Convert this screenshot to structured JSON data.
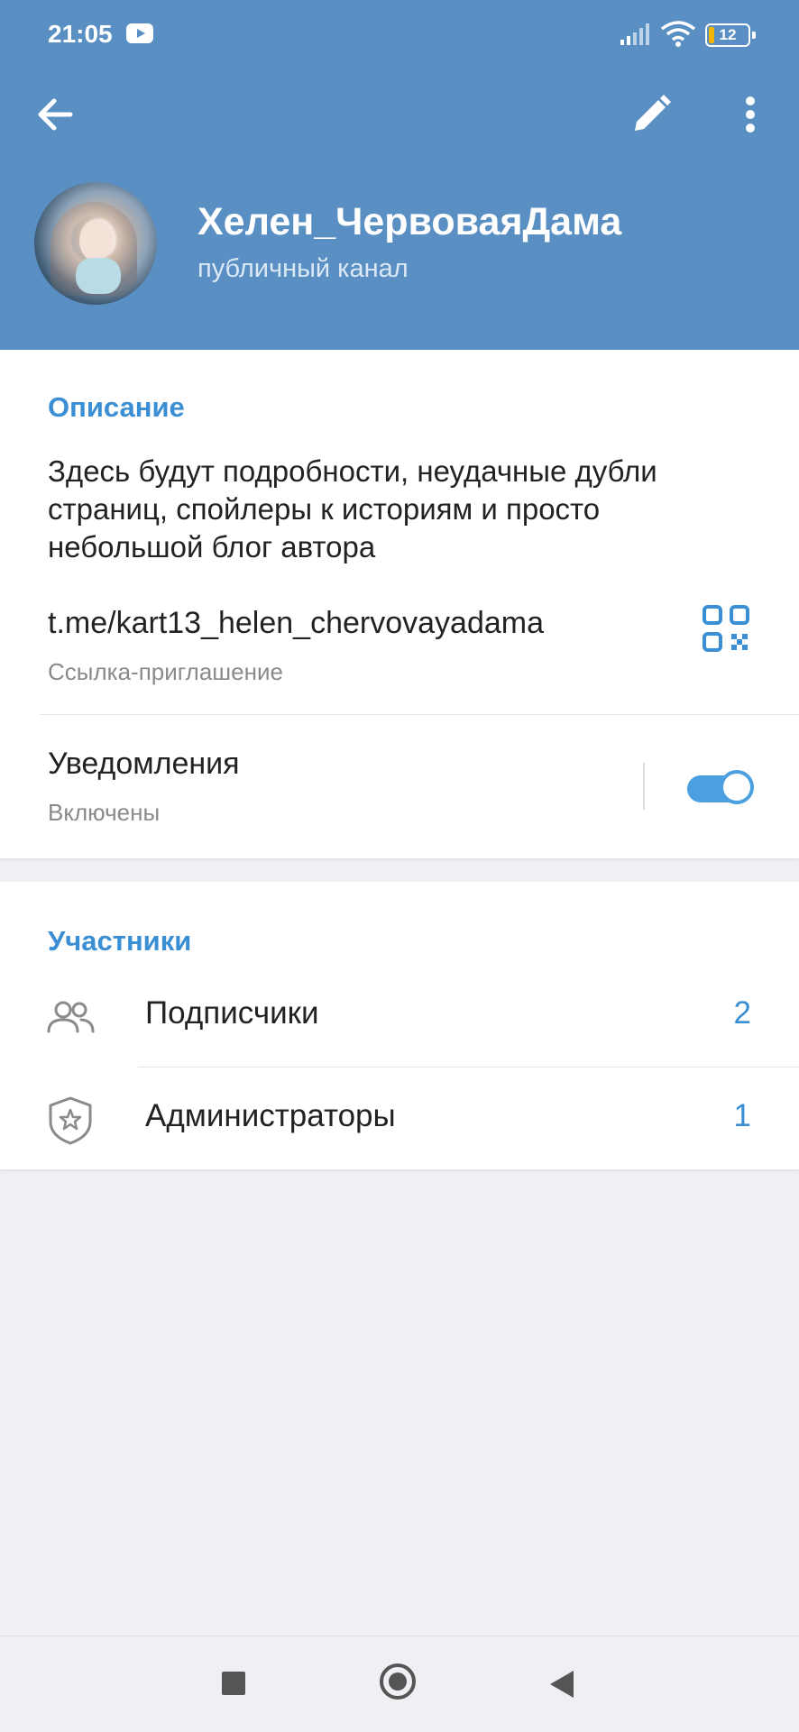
{
  "status_bar": {
    "time": "21:05",
    "battery": "12"
  },
  "header": {
    "channel_name": "Хелен_ЧервоваяДама",
    "channel_type": "публичный канал",
    "accent_color": "#5a8fc3"
  },
  "info": {
    "description_title": "Описание",
    "description": "Здесь будут подробности, неудачные дубли страниц, спойлеры к историям и просто небольшой блог автора",
    "link": "t.me/kart13_helen_chervovayadama",
    "link_caption": "Ссылка-приглашение",
    "notifications_label": "Уведомления",
    "notifications_status": "Включены",
    "notifications_enabled": true
  },
  "members": {
    "title": "Участники",
    "items": [
      {
        "label": "Подписчики",
        "count": "2",
        "icon": "people-icon"
      },
      {
        "label": "Администраторы",
        "count": "1",
        "icon": "shield-star-icon"
      }
    ]
  },
  "colors": {
    "link_blue": "#3a8ed3",
    "toggle_on": "#4aa0e0"
  }
}
